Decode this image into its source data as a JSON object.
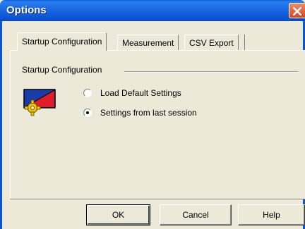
{
  "window": {
    "title": "Options",
    "title_color": "#ffffff",
    "titlebar_color": "#0b55d4",
    "close_button_color": "#d6441e"
  },
  "tabs": [
    {
      "label": "Startup Configuration",
      "active": true
    },
    {
      "label": "Measurement",
      "active": false
    },
    {
      "label": "CSV Export",
      "active": false
    }
  ],
  "panel": {
    "group_label": "Startup Configuration",
    "icon": "settings-icon",
    "options": [
      {
        "label": "Load Default Settings",
        "checked": false
      },
      {
        "label": "Settings from last session",
        "checked": true
      }
    ]
  },
  "buttons": {
    "ok": "OK",
    "cancel": "Cancel",
    "help": "Help"
  }
}
